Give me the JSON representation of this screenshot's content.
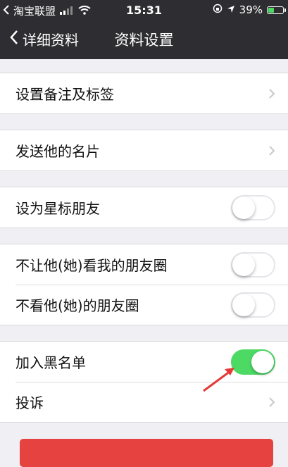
{
  "status_bar": {
    "carrier": "淘宝联盟",
    "time": "15:31",
    "battery": "39%"
  },
  "nav": {
    "back_label": "详细资料",
    "title": "资料设置"
  },
  "rows": {
    "remark": "设置备注及标签",
    "send_card": "发送他的名片",
    "star_friend": "设为星标朋友",
    "hide_my_moments": "不让他(她)看我的朋友圈",
    "hide_their_moments": "不看他(她)的朋友圈",
    "blacklist": "加入黑名单",
    "report": "投诉"
  },
  "toggles": {
    "star_friend": false,
    "hide_my_moments": false,
    "hide_their_moments": false,
    "blacklist": true
  },
  "colors": {
    "nav_background": "#2e2e32",
    "switch_on": "#4cd964",
    "annotation_arrow": "#e53935",
    "danger_button": "#e64340"
  }
}
